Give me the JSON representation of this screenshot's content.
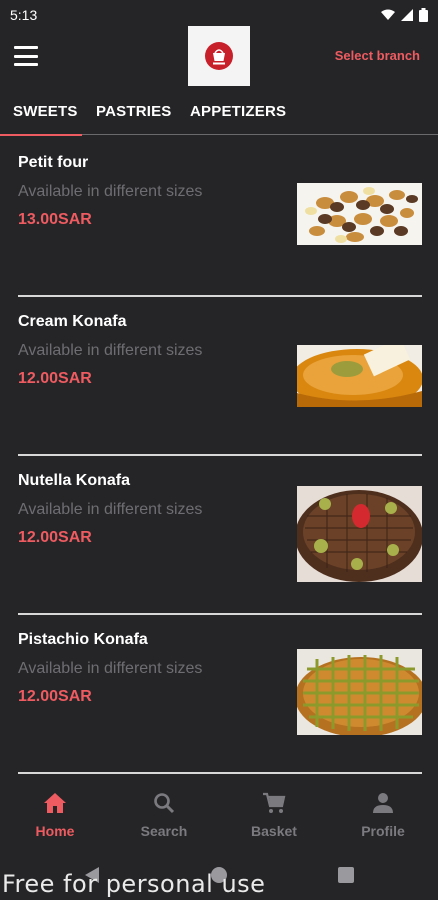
{
  "status_bar": {
    "time": "5:13",
    "icons": [
      "wifi-icon",
      "signal-icon",
      "battery-icon"
    ]
  },
  "header": {
    "logo": "store-logo",
    "select_branch": "Select branch",
    "menu_icon": "menu-icon"
  },
  "tabs": [
    {
      "label": "SWEETS",
      "active": true
    },
    {
      "label": "PASTRIES",
      "active": false
    },
    {
      "label": "APPETIZERS",
      "active": false
    }
  ],
  "products": [
    {
      "name": "Petit four",
      "description": "Available in different sizes",
      "price": "13.00SAR",
      "image": "petit-four-photo"
    },
    {
      "name": "Cream Konafa",
      "description": "Available in different sizes",
      "price": "12.00SAR",
      "image": "cream-konafa-photo"
    },
    {
      "name": "Nutella Konafa",
      "description": "Available in different sizes",
      "price": "12.00SAR",
      "image": "nutella-konafa-photo"
    },
    {
      "name": "Pistachio Konafa",
      "description": "Available in different sizes",
      "price": "12.00SAR",
      "image": "pistachio-konafa-photo"
    }
  ],
  "bottom_nav": [
    {
      "label": "Home",
      "icon": "home-icon",
      "active": true
    },
    {
      "label": "Search",
      "icon": "search-icon",
      "active": false
    },
    {
      "label": "Basket",
      "icon": "cart-icon",
      "active": false
    },
    {
      "label": "Profile",
      "icon": "person-icon",
      "active": false
    }
  ],
  "watermark": "Free for personal use",
  "colors": {
    "background": "#252528",
    "accent": "#ee5b60",
    "muted_text": "#6e6e72",
    "inactive_nav": "#7b7b7f"
  }
}
